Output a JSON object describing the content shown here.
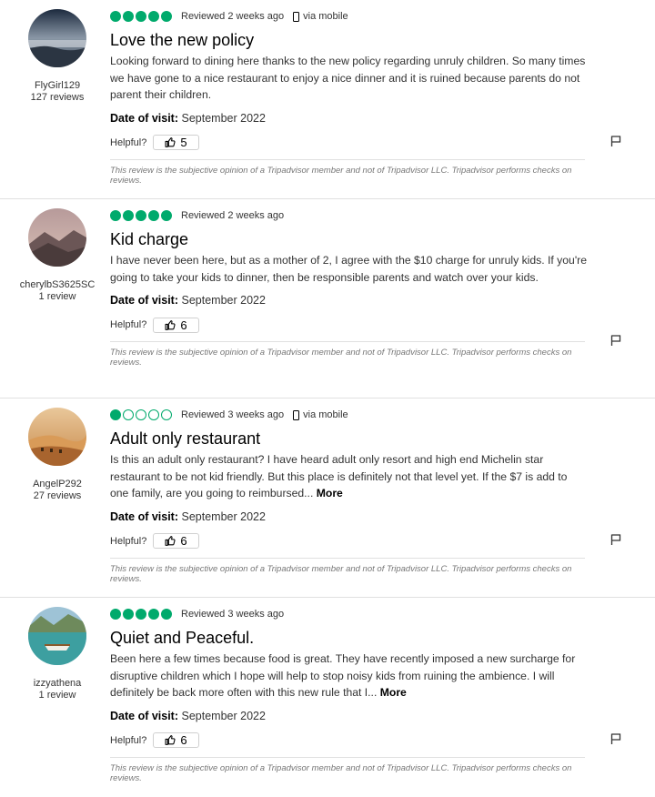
{
  "reviews": [
    {
      "username": "FlyGirl129",
      "review_count": "127 reviews",
      "rating": 5,
      "date": "Reviewed 2 weeks ago",
      "via_mobile": "via mobile",
      "title": "Love the new policy",
      "body": "Looking forward to dining here thanks to the new policy regarding unruly children. So many times we have gone to a nice restaurant to enjoy a nice dinner and it is ruined because parents do not parent their children.",
      "more": "",
      "visit_label": "Date of visit:",
      "visit_date": "September 2022",
      "helpful_label": "Helpful?",
      "helpful_count": "5",
      "disclaimer": "This review is the subjective opinion of a Tripadvisor member and not of Tripadvisor LLC. Tripadvisor performs checks on reviews."
    },
    {
      "username": "cherylbS3625SC",
      "review_count": "1 review",
      "rating": 5,
      "date": "Reviewed 2 weeks ago",
      "via_mobile": "",
      "title": "Kid charge",
      "body": "I have never been here, but as a mother of 2, I agree with the $10 charge for unruly kids. If you're going to take your kids to dinner, then be responsible parents and watch over your kids.",
      "more": "",
      "visit_label": "Date of visit:",
      "visit_date": "September 2022",
      "helpful_label": "Helpful?",
      "helpful_count": "6",
      "disclaimer": "This review is the subjective opinion of a Tripadvisor member and not of Tripadvisor LLC. Tripadvisor performs checks on reviews."
    },
    {
      "username": "AngelP292",
      "review_count": "27 reviews",
      "rating": 1,
      "date": "Reviewed 3 weeks ago",
      "via_mobile": "via mobile",
      "title": "Adult only restaurant",
      "body": "Is this an adult only restaurant? I have heard adult only resort and high end Michelin star restaurant to be not kid friendly. But this place is definitely not that level yet. If the $7 is add to one family, are you going to reimbursed... ",
      "more": "More",
      "visit_label": "Date of visit:",
      "visit_date": "September 2022",
      "helpful_label": "Helpful?",
      "helpful_count": "6",
      "disclaimer": "This review is the subjective opinion of a Tripadvisor member and not of Tripadvisor LLC. Tripadvisor performs checks on reviews."
    },
    {
      "username": "izzyathena",
      "review_count": "1 review",
      "rating": 5,
      "date": "Reviewed 3 weeks ago",
      "via_mobile": "",
      "title": "Quiet and Peaceful.",
      "body": "Been here a few times because food is great. They have recently imposed a new surcharge for disruptive children which I hope will help to stop noisy kids from ruining the ambience. I will definitely be back more often with this new rule that I... ",
      "more": "More",
      "visit_label": "Date of visit:",
      "visit_date": "September 2022",
      "helpful_label": "Helpful?",
      "helpful_count": "6",
      "disclaimer": "This review is the subjective opinion of a Tripadvisor member and not of Tripadvisor LLC. Tripadvisor performs checks on reviews."
    }
  ],
  "icons": {
    "rating": "rating-bubble-icon",
    "mobile": "phone-icon",
    "helpful": "thumbs-up-icon",
    "report": "flag-icon"
  },
  "colors": {
    "bubble": "#00aa6c"
  }
}
